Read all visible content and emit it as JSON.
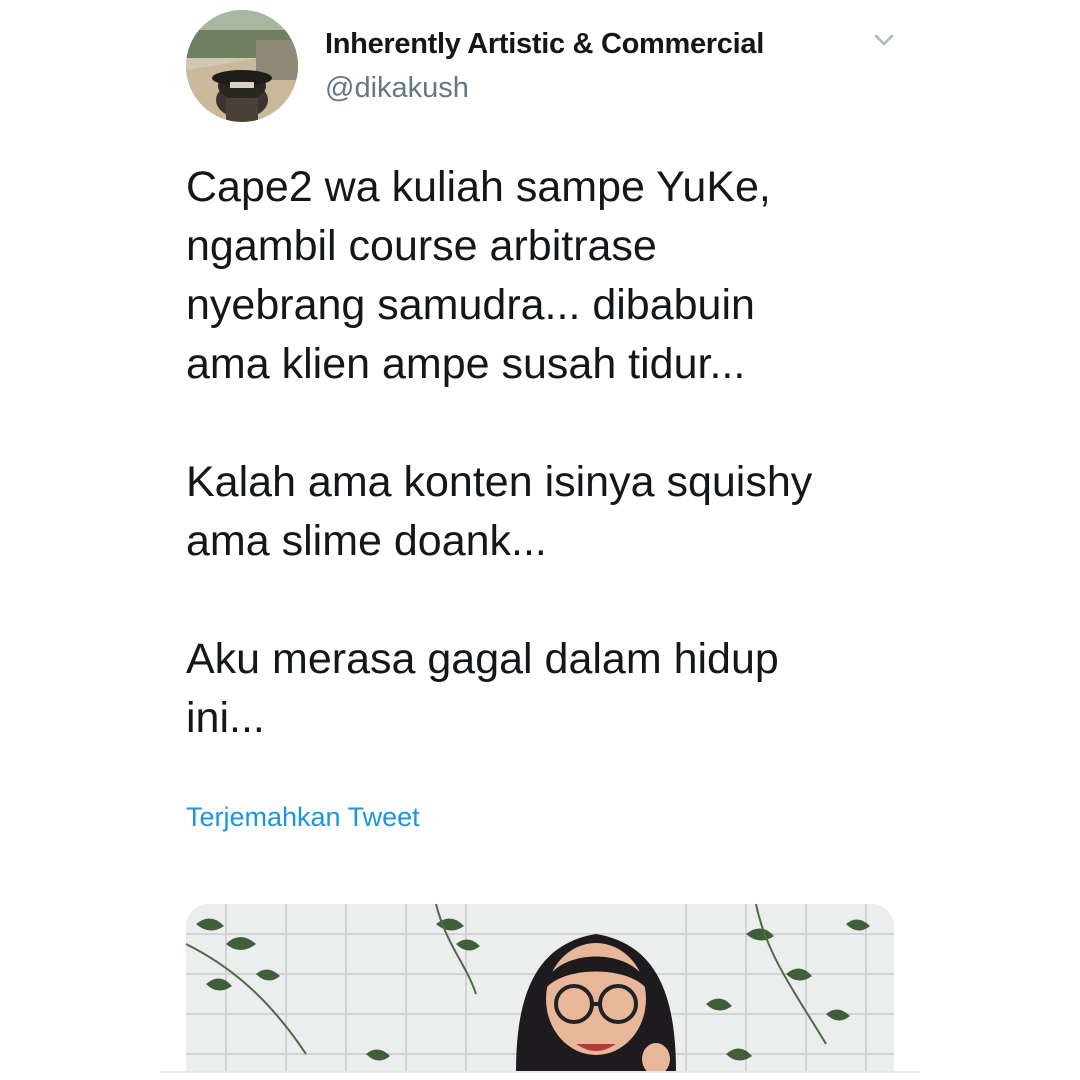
{
  "user": {
    "display_name": "Inherently Artistic & Commercial",
    "handle": "@dikakush"
  },
  "tweet": {
    "text": "Cape2 wa kuliah sampe YuKe,\nngambil course arbitrase\nnyebrang samudra... dibabuin\nama klien ampe susah tidur...\n\nKalah ama konten isinya squishy\nama slime doank...\n\nAku merasa gagal dalam hidup\nini...",
    "translate_label": "Terjemahkan Tweet"
  },
  "icons": {
    "caret": "chevron-down-icon"
  },
  "colors": {
    "text": "#14171a",
    "handle": "#657786",
    "link": "#1b95e0"
  }
}
